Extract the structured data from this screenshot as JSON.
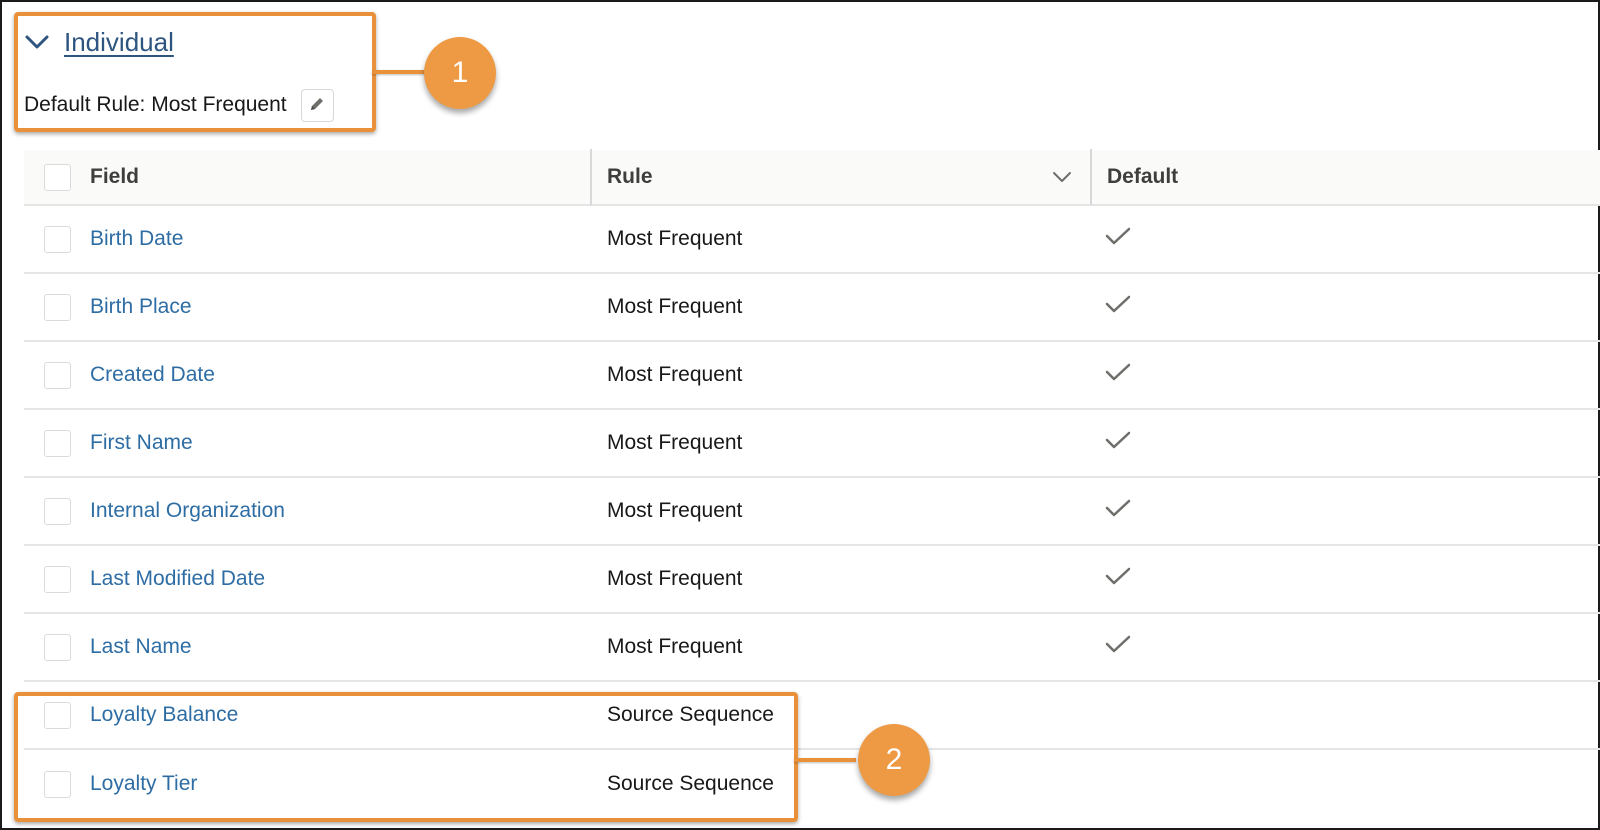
{
  "section": {
    "title": "Individual",
    "default_rule_label": "Default Rule: Most Frequent",
    "edit_icon": "pencil-icon",
    "toggle_icon": "chevron-down-icon"
  },
  "table": {
    "columns": [
      {
        "label": "Field"
      },
      {
        "label": "Rule",
        "menu_icon": "chevron-down-icon"
      },
      {
        "label": "Default"
      }
    ],
    "rows": [
      {
        "field": "Birth Date",
        "rule": "Most Frequent",
        "default": true
      },
      {
        "field": "Birth Place",
        "rule": "Most Frequent",
        "default": true
      },
      {
        "field": "Created Date",
        "rule": "Most Frequent",
        "default": true
      },
      {
        "field": "First Name",
        "rule": "Most Frequent",
        "default": true
      },
      {
        "field": "Internal Organization",
        "rule": "Most Frequent",
        "default": true
      },
      {
        "field": "Last Modified Date",
        "rule": "Most Frequent",
        "default": true
      },
      {
        "field": "Last Name",
        "rule": "Most Frequent",
        "default": true
      },
      {
        "field": "Loyalty Balance",
        "rule": "Source Sequence",
        "default": false
      },
      {
        "field": "Loyalty Tier",
        "rule": "Source Sequence",
        "default": false
      }
    ]
  },
  "callouts": [
    {
      "number": "1"
    },
    {
      "number": "2"
    }
  ],
  "colors": {
    "callout": "#e8913a",
    "link": "#2e6da4",
    "section_title": "#2e5580"
  }
}
